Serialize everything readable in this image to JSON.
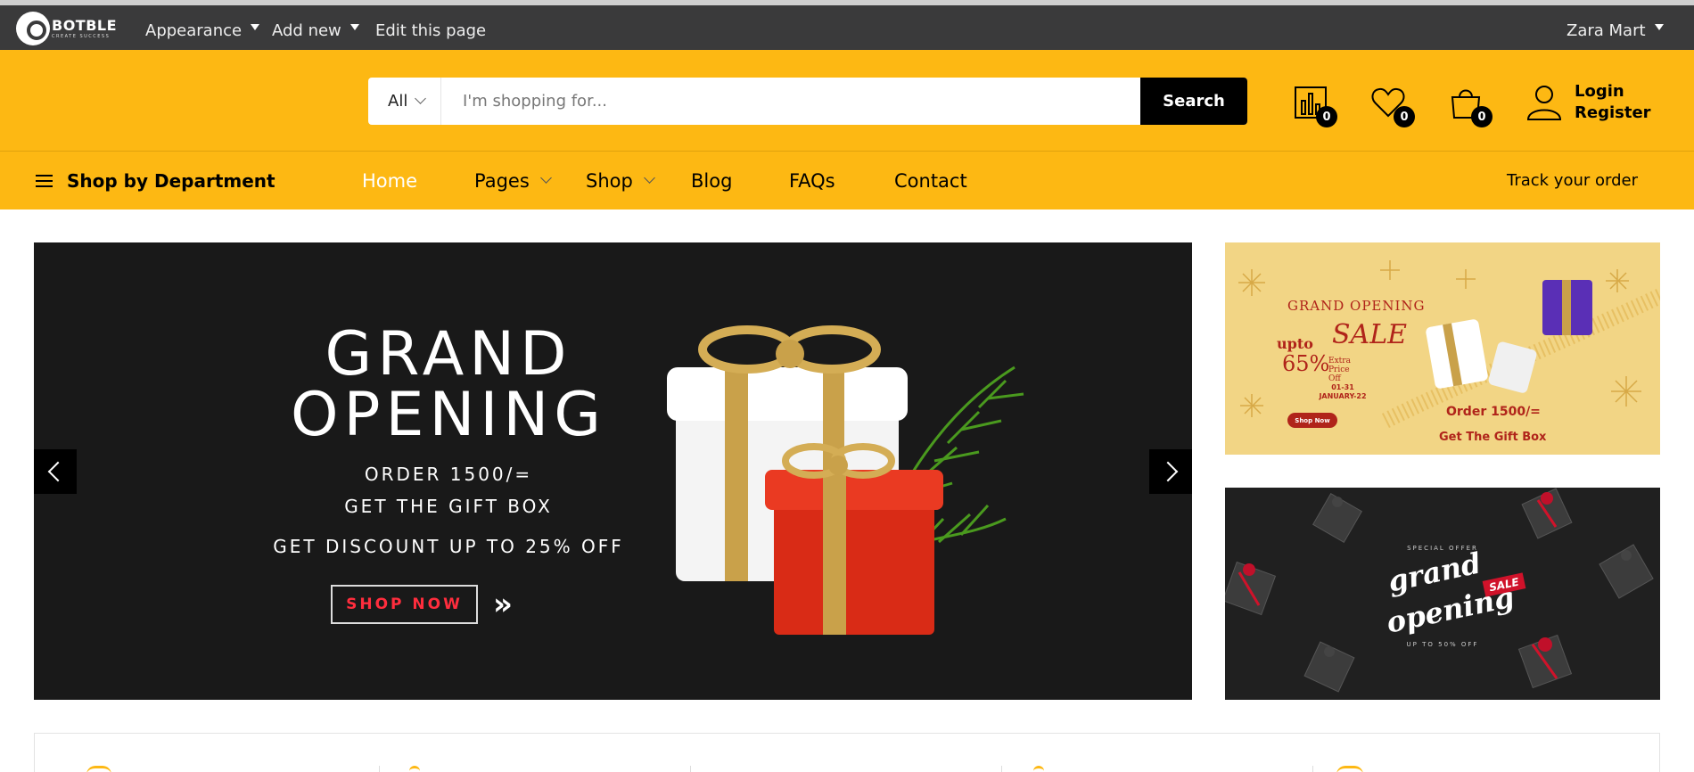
{
  "admin_bar": {
    "logo_text": "BOTBLE",
    "logo_tagline": "CREATE SUCCESS",
    "menu": [
      "Appearance",
      "Add new",
      "Edit this page"
    ],
    "user": "Zara Mart"
  },
  "header": {
    "search": {
      "category": "All",
      "placeholder": "I'm shopping for...",
      "button": "Search"
    },
    "icons": [
      {
        "name": "compare-icon",
        "count": "0"
      },
      {
        "name": "wishlist-icon",
        "count": "0"
      },
      {
        "name": "cart-icon",
        "count": "0"
      }
    ],
    "account": {
      "login": "Login",
      "register": "Register"
    }
  },
  "nav": {
    "department": "Shop by Department",
    "items": [
      "Home",
      "Pages",
      "Shop",
      "Blog",
      "FAQs",
      "Contact"
    ],
    "track": "Track your order"
  },
  "slider": {
    "title_line1": "GRAND",
    "title_line2": "OPENING",
    "line1": "ORDER 1500/=",
    "line2": "GET THE GIFT BOX",
    "discount": "GET DISCOUNT UP TO 25% OFF",
    "cta": "SHOP NOW",
    "cta_suffix": "»"
  },
  "banner1": {
    "title": "GRAND OPENING",
    "sale": "SALE",
    "upto": "upto",
    "percent": "65%",
    "extra": "Extra Price Off",
    "dates": "01-31 JANUARY-22",
    "button": "Shop Now",
    "order": "Order 1500/=",
    "gift": "Get The Gift Box"
  },
  "banner2": {
    "special": "SPECIAL OFFER",
    "grand": "grand",
    "opening": "opening",
    "sale": "SALE",
    "upto": "UP TO 50% OFF"
  },
  "colors": {
    "brand_yellow": "#fdb813",
    "admin_bar": "#3a3a3b",
    "slider_bg": "#191919",
    "cta_red": "#ff2d3d",
    "banner_red": "#b0241a"
  }
}
